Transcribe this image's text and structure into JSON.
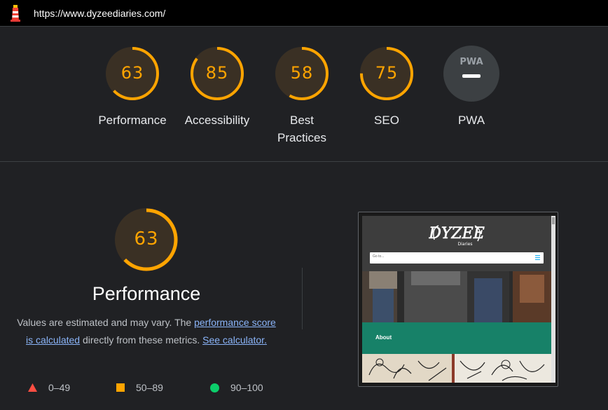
{
  "header": {
    "url": "https://www.dyzeediaries.com/"
  },
  "colors": {
    "average": "#ffa400",
    "fail": "#ff4e42",
    "pass": "#0cce6b",
    "pwa_gray": "#3c4043"
  },
  "gauges": [
    {
      "score": "63",
      "label": "Performance",
      "value": 0.63
    },
    {
      "score": "85",
      "label": "Accessibility",
      "value": 0.85
    },
    {
      "score": "58",
      "label": "Best Practices",
      "value": 0.58
    },
    {
      "score": "75",
      "label": "SEO",
      "value": 0.75
    },
    {
      "score": "",
      "label": "PWA",
      "badge": "PWA"
    }
  ],
  "performance": {
    "score": "63",
    "value": 0.63,
    "title": "Performance",
    "desc_prefix": "Values are estimated and may vary. The ",
    "link1": "performance score is calculated",
    "desc_middle": " directly from these metrics. ",
    "link2": "See calculator."
  },
  "legend": [
    {
      "range": "0–49",
      "icon": "triangle-icon"
    },
    {
      "range": "50–89",
      "icon": "square-icon"
    },
    {
      "range": "90–100",
      "icon": "circle-icon"
    }
  ],
  "screenshot": {
    "logo_text": "DYZEE",
    "logo_subtext": "Diaries",
    "search_placeholder": "Go to...",
    "about": "About"
  }
}
